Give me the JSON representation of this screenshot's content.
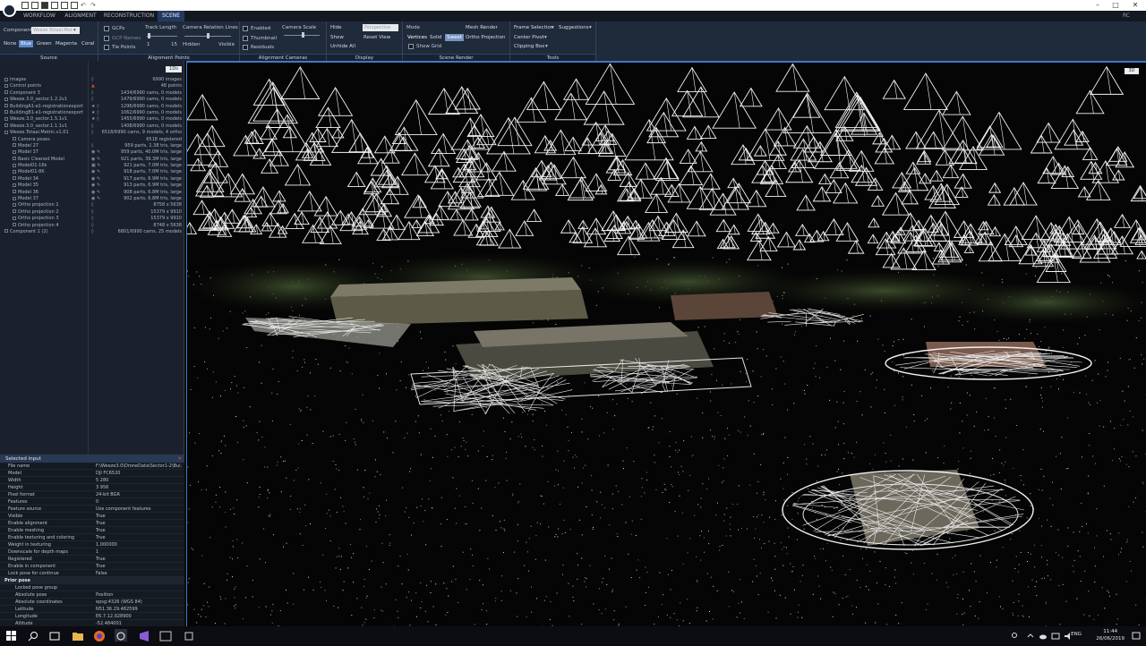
{
  "window": {
    "min": "–",
    "max": "□",
    "close": "✕",
    "user": "RC"
  },
  "menu": {
    "tabs": [
      "WORKFLOW",
      "ALIGNMENT",
      "RECONSTRUCTION",
      "SCENE"
    ],
    "active": "SCENE"
  },
  "ribbon": {
    "source": {
      "title": "Source",
      "component_label": "Component",
      "component_value": "Weeze.Totaal.Met",
      "colors": [
        "None",
        "Blue",
        "Green",
        "Magenta",
        "Coral"
      ],
      "selected_color": "Blue"
    },
    "alignment_points": {
      "title": "Alignment Points",
      "gcps": "GCPs",
      "gcp_names": "GCP Names",
      "tie_points": "Tie Points",
      "track_length": "Track Length",
      "track_min": "1",
      "track_max": "15",
      "camera_relation_lines": "Camera Relation Lines",
      "hidden": "Hidden",
      "visible": "Visible"
    },
    "alignment_cameras": {
      "title": "Alignment Cameras",
      "enabled": "Enabled",
      "thumbnail": "Thumbnail",
      "residuals": "Residuals",
      "camera_scale": "Camera Scale"
    },
    "display": {
      "title": "Display",
      "hide": "Hide",
      "show": "Show",
      "unhide_all": "Unhide All",
      "projection": "Perspective",
      "reset_view": "Reset View"
    },
    "scene_render": {
      "title": "Scene Render",
      "mode": "Mode",
      "vertices": "Vertices",
      "solid": "Solid",
      "sweet": "Sweet",
      "show_grid": "Show Grid",
      "mesh_render": "Mesh Render",
      "ortho_projection": "Ortho Projection"
    },
    "tools": {
      "title": "Tools",
      "frame_selection": "Frame Selection",
      "suggestions": "Suggestions",
      "center_pivot": "Center Pivot",
      "clipping_box": "Clipping Box"
    }
  },
  "tree": {
    "badge": "1Ds",
    "rows": [
      {
        "label": "Images",
        "value": "6990 images",
        "icon": "◊"
      },
      {
        "label": "Control points",
        "value": "48 points",
        "icon": "▲",
        "red": true
      },
      {
        "label": "Component 3",
        "value": "1434/6990 cams, 0 models",
        "icon": "◊"
      },
      {
        "label": "Weeze.3.0_sector.1.2.2v1",
        "value": "1479/6990 cams, 0 models",
        "icon": "◊"
      },
      {
        "label": "BuildingA1-e1-registrationexport",
        "value": "1296/6990 cams, 0 models",
        "icon": "★ ◊"
      },
      {
        "label": "BuildingB1-e1-registrationexport",
        "value": "1062/6990 cams, 0 models",
        "icon": "★ ◊"
      },
      {
        "label": "Weeze.3.0_sector.1.5.1v1",
        "value": "1455/6990 cams, 0 models",
        "icon": "★ ◊"
      },
      {
        "label": "Weeze.3.0_sector.1.1.1v1",
        "value": "1408/6990 cams, 0 models",
        "icon": "◊"
      },
      {
        "label": "Weeze.Totaal.Metric.v1.01",
        "value": "6518/6990 cams, 9 models, 4 ortho",
        "icon": "◊"
      },
      {
        "label": "Camera poses",
        "value": "6518 registered",
        "icon": ""
      },
      {
        "label": "Model 27",
        "value": "959 parts, 1.38 tris, large",
        "icon": "◊"
      },
      {
        "label": "Model 37",
        "value": "959 parts, 40.0M tris, large",
        "icon": "◉ ✎"
      },
      {
        "label": "Basic Cleaned Model",
        "value": "921 parts, 39.3M tris, large",
        "icon": "◉ ✎"
      },
      {
        "label": "Model01-16k",
        "value": "921 parts, 7.0M tris, large",
        "icon": "▣ ✎"
      },
      {
        "label": "Model01-8K",
        "value": "918 parts, 7.0M tris, large",
        "icon": "◉ ✎"
      },
      {
        "label": "Model 34",
        "value": "917 parts, 6.9M tris, large",
        "icon": "◉ ✎"
      },
      {
        "label": "Model 35",
        "value": "913 parts, 6.9M tris, large",
        "icon": "◉ ✎"
      },
      {
        "label": "Model 36",
        "value": "908 parts, 6.8M tris, large",
        "icon": "◉ ✎"
      },
      {
        "label": "Model 37",
        "value": "902 parts, 6.8M tris, large",
        "icon": "◉ ✎"
      },
      {
        "label": "Ortho projection 1",
        "value": "8758 x 5638",
        "icon": "◊"
      },
      {
        "label": "Ortho projection 2",
        "value": "15379 x 9910",
        "icon": "◊"
      },
      {
        "label": "Ortho projection 3",
        "value": "15379 x 9910",
        "icon": "◊"
      },
      {
        "label": "Ortho projection 4",
        "value": "8748 x 5638",
        "icon": "◊"
      },
      {
        "label": "Component 1 (2)",
        "value": "6801/6990 cams, 25 models",
        "icon": "◊"
      }
    ]
  },
  "inspector": {
    "title": "Selected input",
    "rows": [
      {
        "k": "File name",
        "v": "F:\\Weeze3.0\\DroneData\\Sector1-2\\Bui..."
      },
      {
        "k": "Model",
        "v": "DJI FC6520"
      },
      {
        "k": "Width",
        "v": "5 280"
      },
      {
        "k": "Height",
        "v": "3 956"
      },
      {
        "k": "Pixel format",
        "v": "24-bit BGR"
      },
      {
        "k": "Features",
        "v": "0"
      },
      {
        "k": "Feature source",
        "v": "Use component features"
      },
      {
        "k": "Visible",
        "v": "True"
      },
      {
        "k": "Enable alignment",
        "v": "True"
      },
      {
        "k": "Enable meshing",
        "v": "True"
      },
      {
        "k": "Enable texturing and coloring",
        "v": "True"
      },
      {
        "k": "Weight in texturing",
        "v": "1.000000"
      },
      {
        "k": "Downscale for depth maps",
        "v": "1"
      },
      {
        "k": "Registered",
        "v": "True"
      },
      {
        "k": "Enable in component",
        "v": "True"
      },
      {
        "k": "Lock pose for continue",
        "v": "False"
      },
      {
        "k": "Prior pose",
        "v": "",
        "group": true
      },
      {
        "k": "Locked pose group",
        "v": "",
        "sub": true
      },
      {
        "k": "Absolute pose",
        "v": "Position",
        "sub": true
      },
      {
        "k": "Absolute coordinates",
        "v": "epsg:4326 (WGS 84)",
        "sub": true
      },
      {
        "k": "Latitude",
        "v": "N51.36.29.482599",
        "sub": true
      },
      {
        "k": "Longitude",
        "v": "E6.7.12.928900",
        "sub": true
      },
      {
        "k": "Altitude",
        "v": "-52.484001",
        "sub": true
      }
    ]
  },
  "viewport": {
    "badge": "3D"
  },
  "taskbar": {
    "lang": "ENG",
    "time": "11:44",
    "date": "26/06/2019"
  }
}
